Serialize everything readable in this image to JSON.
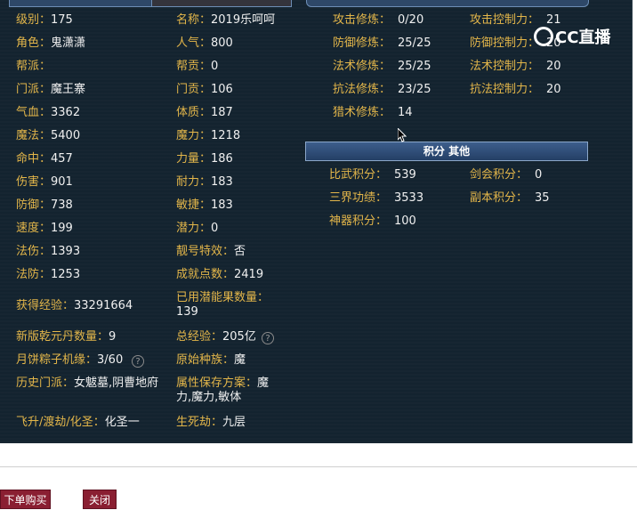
{
  "left": [
    {
      "label": "级别：",
      "value": "175"
    },
    {
      "label": "角色：",
      "value": "鬼潇潇"
    },
    {
      "label": "帮派：",
      "value": ""
    },
    {
      "label": "门派：",
      "value": "魔王寨"
    },
    {
      "label": "气血：",
      "value": "3362"
    },
    {
      "label": "魔法：",
      "value": "5400"
    },
    {
      "label": "命中：",
      "value": "457"
    },
    {
      "label": "伤害：",
      "value": "901"
    },
    {
      "label": "防御：",
      "value": "738"
    },
    {
      "label": "速度：",
      "value": "199"
    },
    {
      "label": "法伤：",
      "value": "1393"
    },
    {
      "label": "法防：",
      "value": "1253"
    }
  ],
  "right": [
    {
      "label": "名称：",
      "value": "2019乐呵呵"
    },
    {
      "label": "人气：",
      "value": "800"
    },
    {
      "label": "帮贡：",
      "value": "0"
    },
    {
      "label": "门贡：",
      "value": "106"
    },
    {
      "label": "体质：",
      "value": "187"
    },
    {
      "label": "魔力：",
      "value": "1218"
    },
    {
      "label": "力量：",
      "value": "186"
    },
    {
      "label": "耐力：",
      "value": "183"
    },
    {
      "label": "敏捷：",
      "value": "183"
    },
    {
      "label": "潜力：",
      "value": "0"
    },
    {
      "label": "靓号特效：",
      "value": "否"
    },
    {
      "label": "成就点数：",
      "value": "2419"
    }
  ],
  "exp": {
    "label": "获得经验：",
    "value": "33291664"
  },
  "used_potential": {
    "label": "已用潜能果数量：",
    "value": "139"
  },
  "qianyuan": {
    "label": "新版乾元丹数量：",
    "value": "9"
  },
  "total_exp": {
    "label": "总经验：",
    "value": "205亿",
    "help": "?"
  },
  "mooncake": {
    "label": "月饼粽子机缘：",
    "value": "3/60",
    "help": "?"
  },
  "race": {
    "label": "原始种族：",
    "value": "魔"
  },
  "history": {
    "label": "历史门派：",
    "value": "女魃墓,阴曹地府"
  },
  "save_plan": {
    "label": "属性保存方案：",
    "value": "魔力,魔力,敏体"
  },
  "ascend": {
    "label": "飞升/渡劫/化圣：",
    "value": "化圣一"
  },
  "life_death": {
    "label": "生死劫：",
    "value": "九层"
  },
  "cultivation": [
    {
      "label": "攻击修炼：",
      "value": "0/20"
    },
    {
      "label": "防御修炼：",
      "value": "25/25"
    },
    {
      "label": "法术修炼：",
      "value": "25/25"
    },
    {
      "label": "抗法修炼：",
      "value": "23/25"
    },
    {
      "label": "猎术修炼：",
      "value": "14"
    }
  ],
  "control": [
    {
      "label": "攻击控制力：",
      "value": "21"
    },
    {
      "label": "防御控制力：",
      "value": "20"
    },
    {
      "label": "法术控制力：",
      "value": "20"
    },
    {
      "label": "抗法控制力：",
      "value": "20"
    }
  ],
  "points_header": "积分 其他",
  "points": [
    {
      "label": "比武积分：",
      "value": "539"
    },
    {
      "label": "剑会积分：",
      "value": "0"
    },
    {
      "label": "三界功绩：",
      "value": "3533"
    },
    {
      "label": "副本积分：",
      "value": "35"
    },
    {
      "label": "神器积分：",
      "value": "100"
    }
  ],
  "logo_text": "CC直播",
  "buttons": {
    "buy": "下单购买",
    "close": "关闭"
  }
}
